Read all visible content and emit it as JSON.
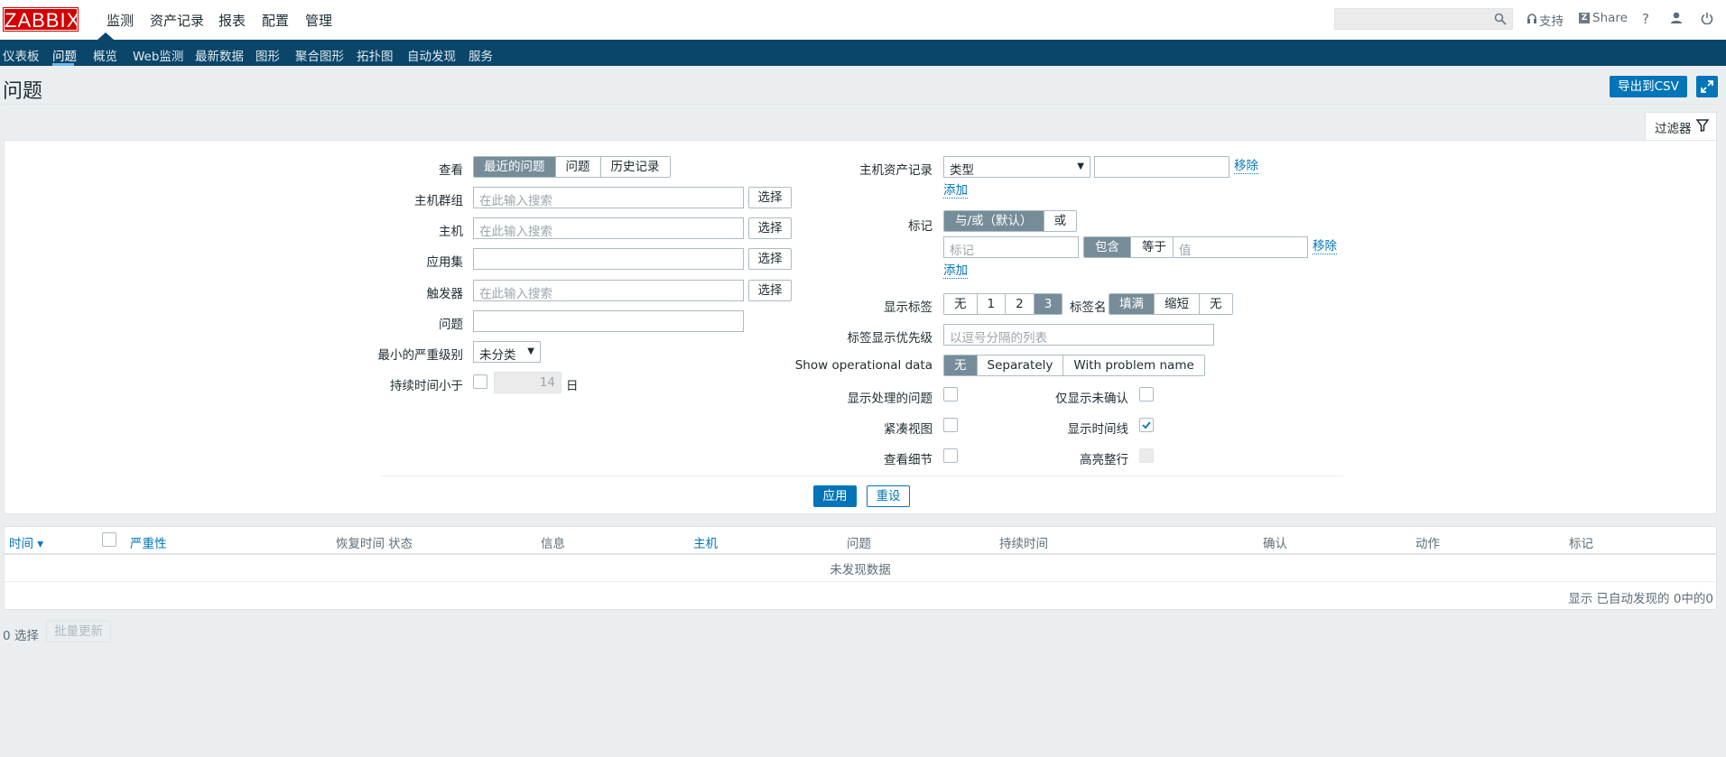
{
  "header": {
    "logo": "ZABBIX",
    "menu": [
      "监测",
      "资产记录",
      "报表",
      "配置",
      "管理"
    ],
    "support": "支持",
    "share": "Share",
    "help": "?"
  },
  "nav": {
    "items": [
      "仪表板",
      "问题",
      "概览",
      "Web监测",
      "最新数据",
      "图形",
      "聚合图形",
      "拓扑图",
      "自动发现",
      "服务"
    ],
    "active": "问题"
  },
  "page": {
    "title": "问题",
    "export_csv": "导出到CSV",
    "filter_tab": "过滤器"
  },
  "filter": {
    "view_label": "查看",
    "view_options": [
      "最近的问题",
      "问题",
      "历史记录"
    ],
    "view_selected": "最近的问题",
    "hostgroup_label": "主机群组",
    "hostgroup_placeholder": "在此输入搜索",
    "host_label": "主机",
    "host_placeholder": "在此输入搜索",
    "application_label": "应用集",
    "trigger_label": "触发器",
    "trigger_placeholder": "在此输入搜索",
    "problem_label": "问题",
    "severity_label": "最小的严重级别",
    "severity_value": "未分类",
    "age_label": "持续时间小于",
    "age_value": "14",
    "age_unit": "日",
    "select": "选择",
    "inventory_label": "主机资产记录",
    "inventory_field": "类型",
    "remove": "移除",
    "add": "添加",
    "tags_label": "标记",
    "tags_operator": [
      "与/或（默认）",
      "或"
    ],
    "tag_placeholder": "标记",
    "tag_ops": [
      "包含",
      "等于"
    ],
    "value_placeholder": "值",
    "show_tags_label": "显示标签",
    "show_tags_options": [
      "无",
      "1",
      "2",
      "3"
    ],
    "show_tags_selected": "3",
    "tag_name_label": "标签名",
    "tag_name_options": [
      "填满",
      "缩短",
      "无"
    ],
    "tag_name_selected": "填满",
    "tag_priority_label": "标签显示优先级",
    "tag_priority_placeholder": "以逗号分隔的列表",
    "opdata_label": "Show operational data",
    "opdata_options": [
      "无",
      "Separately",
      "With problem name"
    ],
    "opdata_selected": "无",
    "show_suppressed": "显示处理的问题",
    "unacknowledged_only": "仅显示未确认",
    "compact_view": "紧凑视图",
    "show_timeline": "显示时间线",
    "show_timeline_checked": true,
    "show_details": "查看细节",
    "highlight_row": "高亮整行",
    "apply": "应用",
    "reset": "重设"
  },
  "table": {
    "columns": [
      "时间 ▾",
      "严重性",
      "恢复时间",
      "状态",
      "信息",
      "主机",
      "问题",
      "持续时间",
      "确认",
      "动作",
      "标记"
    ],
    "empty": "未发现数据",
    "footer": "显示 已自动发现的 0中的0"
  },
  "bottom": {
    "selected": "0 选择",
    "mass_update": "批量更新"
  },
  "colors": {
    "nav": "#0a466a",
    "accent": "#0275b8",
    "logo": "#d40000",
    "segment_active": "#768d99"
  }
}
